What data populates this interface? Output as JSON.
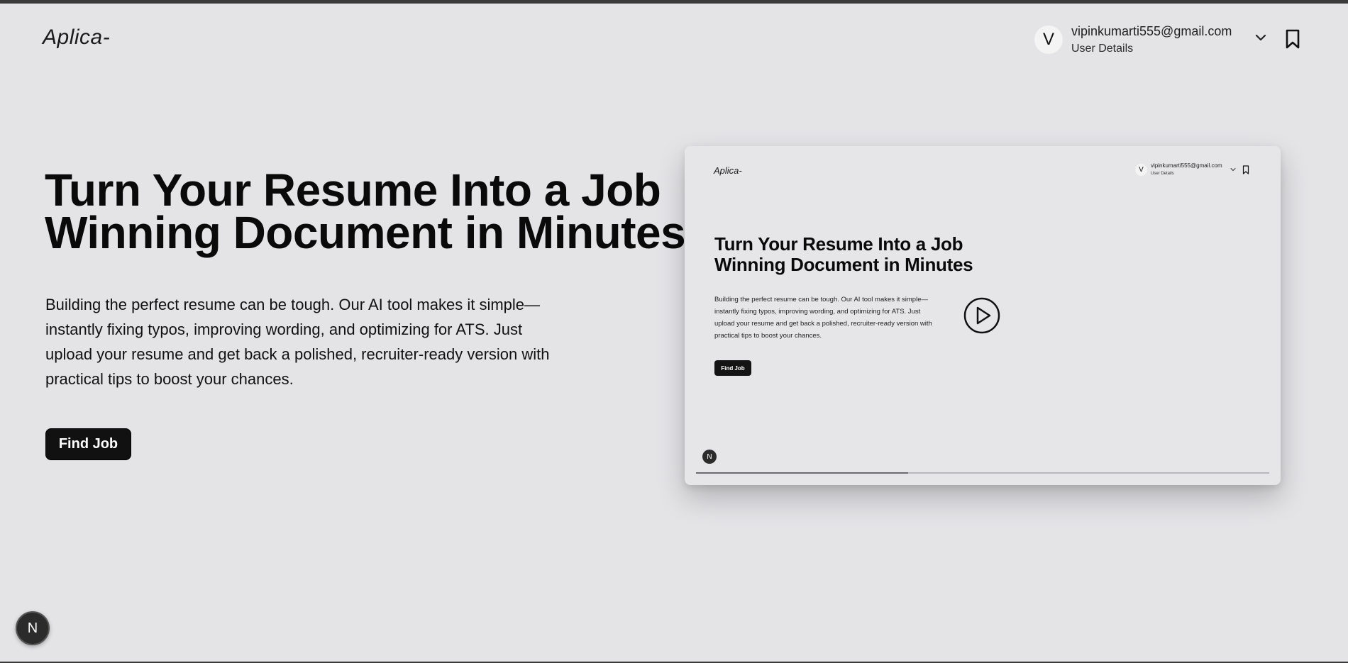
{
  "header": {
    "logo": "Aplica-",
    "user": {
      "avatar_initial": "V",
      "email": "vipinkumarti555@gmail.com",
      "subtitle": "User Details"
    },
    "icons": [
      "chevron-down-icon",
      "bookmark-icon"
    ]
  },
  "hero": {
    "title_line1": "Turn Your Resume Into a Job",
    "title_line2": "Winning Document in Minutes",
    "description": "Building the perfect resume can be tough. Our AI tool makes it simple—instantly fixing typos, improving wording, and optimizing for ATS. Just upload your resume and get back a polished, recruiter-ready version with practical tips to boost your chances.",
    "cta_label": "Find Job"
  },
  "preview": {
    "logo": "Aplica-",
    "avatar_initial": "V",
    "email": "vipinkumarti555@gmail.com",
    "subtitle": "User Details",
    "title_line1": "Turn Your Resume Into a Job",
    "title_line2": "Winning Document in Minutes",
    "description": "Building the perfect resume can be tough. Our AI tool makes it simple—instantly fixing typos, improving wording, and optimizing for ATS. Just upload your resume and get back a polished, recruiter-ready version with practical tips to boost your chances.",
    "cta_label": "Find Job",
    "badge": "N",
    "progress": 0.37,
    "icons": [
      "play-icon"
    ]
  },
  "floating_badge": "N",
  "colors": {
    "background": "#e4e4e7",
    "button": "#111111",
    "text": "#0a0a0a"
  }
}
